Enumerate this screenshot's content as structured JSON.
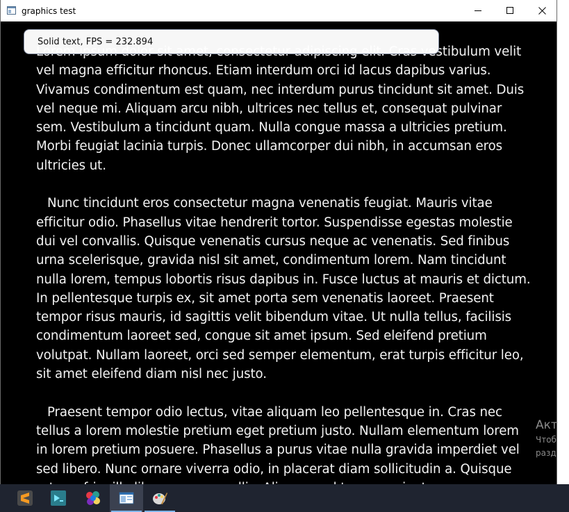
{
  "window": {
    "title": "graphics test"
  },
  "overlay": {
    "fps_text": "Solid text, FPS = 232.894"
  },
  "document": {
    "paragraphs": [
      "Lorem ipsum dolor sit amet, consectetur adipiscing elit. Cras vestibulum velit vel magna efficitur rhoncus. Etiam interdum orci id lacus dapibus varius. Vivamus condimentum est quam, nec interdum purus tincidunt sit amet. Duis vel neque mi. Aliquam arcu nibh, ultrices nec tellus et, consequat pulvinar sem. Vestibulum a tincidunt quam. Nulla congue massa a ultricies pretium. Morbi feugiat lacinia turpis. Donec ullamcorper dui nibh, in accumsan eros ultricies ut.",
      "Nunc tincidunt eros consectetur magna venenatis feugiat. Mauris vitae efficitur odio. Phasellus vitae hendrerit tortor. Suspendisse egestas molestie dui vel convallis. Quisque venenatis cursus neque ac venenatis. Sed finibus urna scelerisque, gravida nisl sit amet, condimentum lorem. Nam tincidunt nulla lorem, tempus lobortis risus dapibus in. Fusce luctus at mauris et dictum. In pellentesque turpis ex, sit amet porta sem venenatis laoreet. Praesent tempor risus mauris, id sagittis velit bibendum vitae. Ut nulla tellus, facilisis condimentum laoreet sed, congue sit amet ipsum. Sed eleifend pretium volutpat. Nullam laoreet, orci sed semper elementum, erat turpis efficitur leo, sit amet eleifend diam nisl nec justo.",
      "Praesent tempor odio lectus, vitae aliquam leo pellentesque in. Cras nec tellus a lorem molestie pretium eget pretium justo. Nullam elementum lorem in lorem pretium posuere. Phasellus a purus vitae nulla gravida imperdiet vel sed libero. Nunc ornare viverra odio, in placerat diam sollicitudin a. Quisque rutrum fringilla libero non convallis. Aliquam vel tempor mi, et"
    ]
  },
  "desktop": {
    "watermark_line1": "Акт",
    "watermark_line2": "Чтоб",
    "watermark_line3": "разд"
  },
  "taskbar": {
    "items": [
      {
        "icon": "sublime-text-icon"
      },
      {
        "icon": "terminal-app-icon"
      },
      {
        "icon": "paint-palette-app-icon"
      },
      {
        "icon": "graphics-test-window-icon",
        "active": true
      },
      {
        "icon": "paint-brush-app-icon"
      }
    ]
  },
  "colors": {
    "background": "#000000",
    "text": "#f2f2f2",
    "taskbar": "#1f2430",
    "active_underline": "#7eb4ea"
  }
}
